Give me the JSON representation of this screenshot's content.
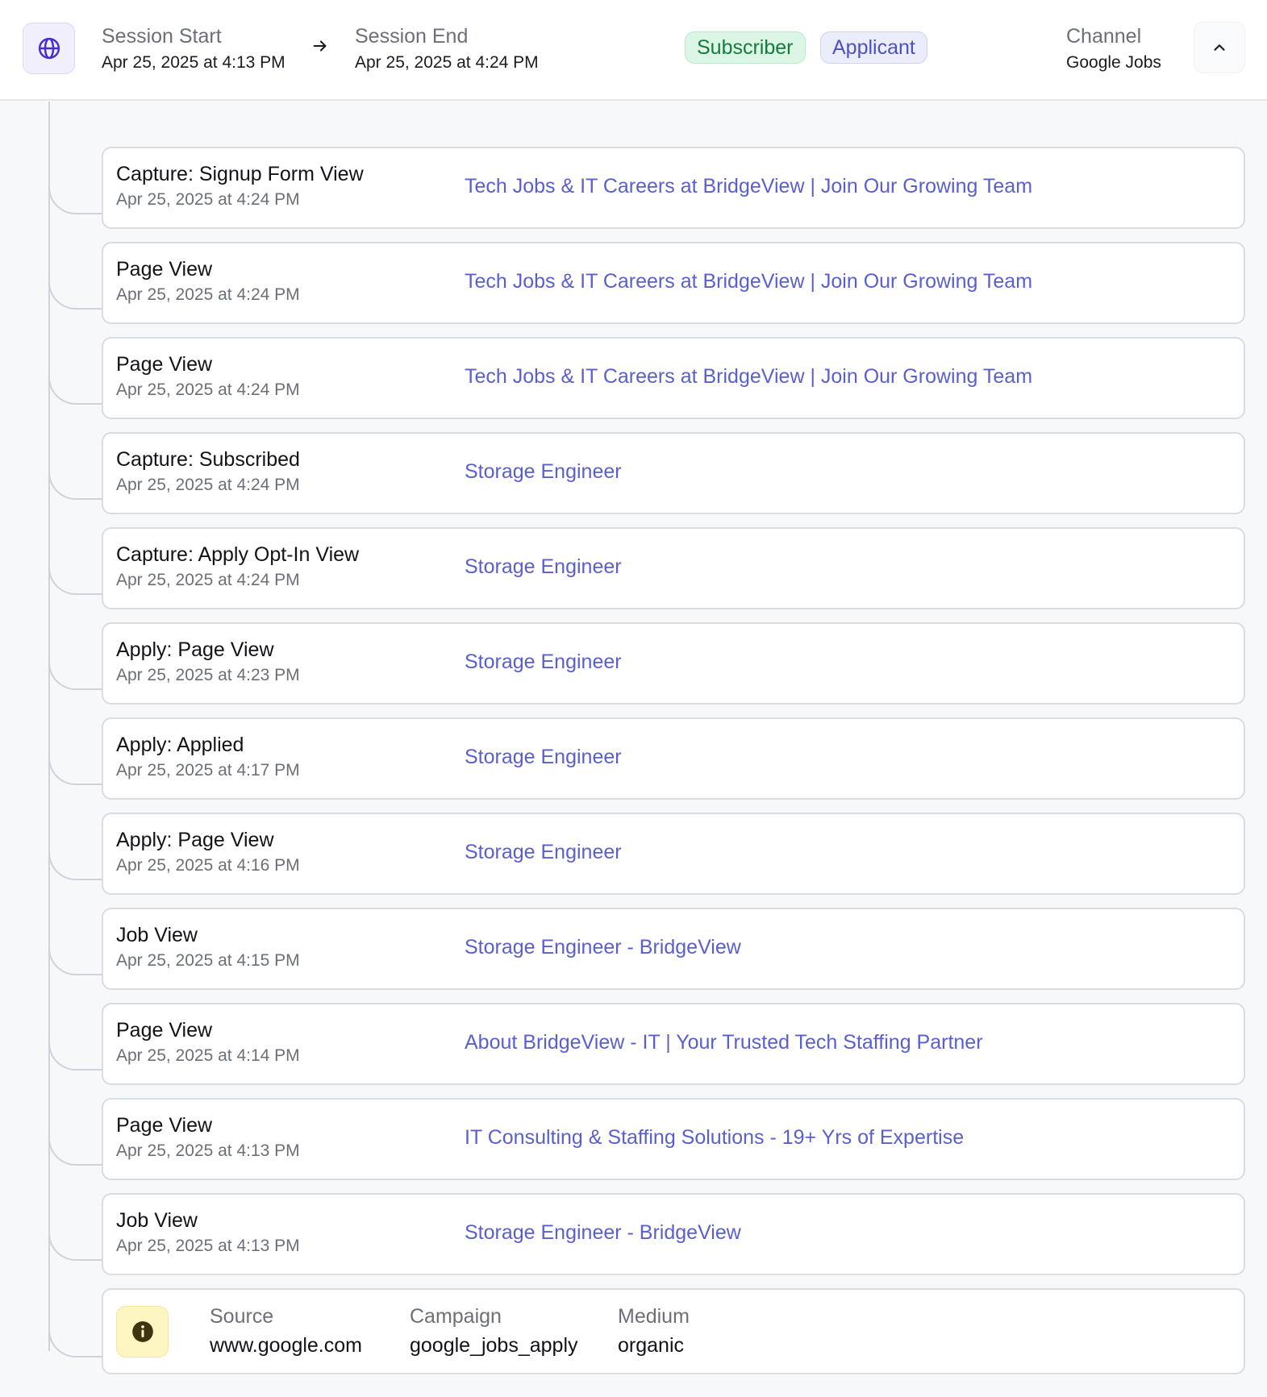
{
  "header": {
    "globe_icon": "globe-icon",
    "session_start_label": "Session Start",
    "session_start_value": "Apr 25, 2025 at 4:13 PM",
    "session_end_label": "Session End",
    "session_end_value": "Apr 25, 2025 at 4:24 PM",
    "badges": {
      "subscriber": "Subscriber",
      "applicant": "Applicant"
    },
    "channel_label": "Channel",
    "channel_value": "Google Jobs",
    "collapse_icon": "chevron-up-icon"
  },
  "events": [
    {
      "title": "Capture: Signup Form View",
      "time": "Apr 25, 2025 at 4:24 PM",
      "link": "Tech Jobs & IT Careers at BridgeView | Join Our Growing Team"
    },
    {
      "title": "Page View",
      "time": "Apr 25, 2025 at 4:24 PM",
      "link": "Tech Jobs & IT Careers at BridgeView | Join Our Growing Team"
    },
    {
      "title": "Page View",
      "time": "Apr 25, 2025 at 4:24 PM",
      "link": "Tech Jobs & IT Careers at BridgeView | Join Our Growing Team"
    },
    {
      "title": "Capture: Subscribed",
      "time": "Apr 25, 2025 at 4:24 PM",
      "link": "Storage Engineer"
    },
    {
      "title": "Capture: Apply Opt-In View",
      "time": "Apr 25, 2025 at 4:24 PM",
      "link": "Storage Engineer"
    },
    {
      "title": "Apply: Page View",
      "time": "Apr 25, 2025 at 4:23 PM",
      "link": "Storage Engineer"
    },
    {
      "title": "Apply: Applied",
      "time": "Apr 25, 2025 at 4:17 PM",
      "link": "Storage Engineer"
    },
    {
      "title": "Apply: Page View",
      "time": "Apr 25, 2025 at 4:16 PM",
      "link": "Storage Engineer"
    },
    {
      "title": "Job View",
      "time": "Apr 25, 2025 at 4:15 PM",
      "link": "Storage Engineer - BridgeView"
    },
    {
      "title": "Page View",
      "time": "Apr 25, 2025 at 4:14 PM",
      "link": "About BridgeView - IT | Your Trusted Tech Staffing Partner"
    },
    {
      "title": "Page View",
      "time": "Apr 25, 2025 at 4:13 PM",
      "link": "IT Consulting & Staffing Solutions - 19+ Yrs of Expertise"
    },
    {
      "title": "Job View",
      "time": "Apr 25, 2025 at 4:13 PM",
      "link": "Storage Engineer - BridgeView"
    }
  ],
  "source": {
    "info_icon": "info-icon",
    "source_label": "Source",
    "source_value": "www.google.com",
    "campaign_label": "Campaign",
    "campaign_value": "google_jobs_apply",
    "medium_label": "Medium",
    "medium_value": "organic"
  },
  "colors": {
    "accent": "#5a5fd0",
    "subscriber_badge": "#157a3e",
    "applicant_badge": "#4b50c4",
    "info_bg": "#fdf6c3"
  }
}
